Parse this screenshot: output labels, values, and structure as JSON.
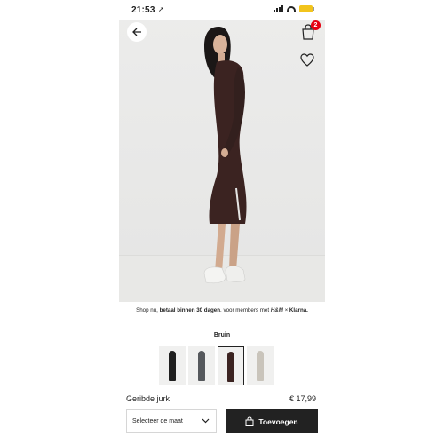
{
  "status_bar": {
    "time": "21:53",
    "location_glyph": "➚"
  },
  "header": {
    "back_icon": "arrow-left-icon",
    "bag_icon": "shopping-bag-icon",
    "bag_count": "2",
    "favorite_icon": "heart-icon"
  },
  "promo": {
    "part1": "Shop nu, ",
    "bold": "betaal binnen 30 dagen",
    "part2": ". voor members met ",
    "brand": "H&M",
    "part3": " × ",
    "klarna": "Klarna."
  },
  "color": {
    "label": "Bruin",
    "swatches": [
      {
        "fill": "#1f1f1f",
        "selected": false
      },
      {
        "fill": "#55585c",
        "selected": false
      },
      {
        "fill": "#3b2321",
        "selected": true
      },
      {
        "fill": "#c9c4bb",
        "selected": false
      }
    ]
  },
  "product": {
    "name": "Geribde jurk",
    "price": "€ 17,99"
  },
  "actions": {
    "size_placeholder": "Selecteer de maat",
    "add_label": "Toevoegen"
  },
  "colors": {
    "accent": "#222222",
    "badge": "#e50010",
    "dress": "#3b2321"
  }
}
